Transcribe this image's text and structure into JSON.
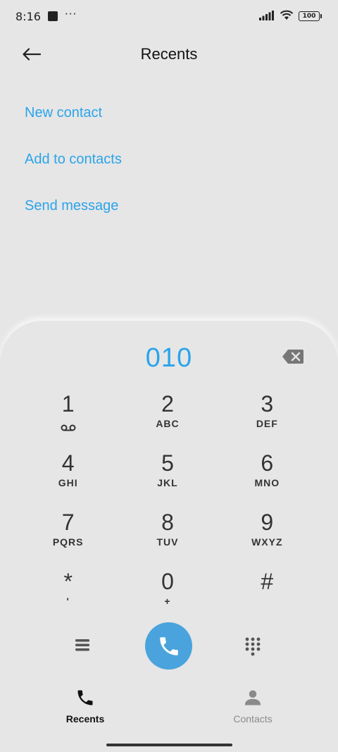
{
  "status_bar": {
    "time": "8:16",
    "dots": "···",
    "battery": "100",
    "icons": [
      "notification-square-icon",
      "signal-icon",
      "wifi-icon",
      "battery-icon"
    ]
  },
  "header": {
    "title": "Recents",
    "back_icon": "back-arrow-icon"
  },
  "actions": [
    {
      "label": "New contact"
    },
    {
      "label": "Add to contacts"
    },
    {
      "label": "Send message"
    }
  ],
  "dialer": {
    "number": "010",
    "backspace_icon": "backspace-icon",
    "keys": [
      {
        "digit": "1",
        "letters": ""
      },
      {
        "digit": "2",
        "letters": "ABC"
      },
      {
        "digit": "3",
        "letters": "DEF"
      },
      {
        "digit": "4",
        "letters": "GHI"
      },
      {
        "digit": "5",
        "letters": "JKL"
      },
      {
        "digit": "6",
        "letters": "MNO"
      },
      {
        "digit": "7",
        "letters": "PQRS"
      },
      {
        "digit": "8",
        "letters": "TUV"
      },
      {
        "digit": "9",
        "letters": "WXYZ"
      },
      {
        "digit": "*",
        "letters": "'"
      },
      {
        "digit": "0",
        "letters": "+"
      },
      {
        "digit": "#",
        "letters": ""
      }
    ],
    "call_icon": "phone-icon"
  },
  "bottom_nav": {
    "items": [
      {
        "label": "Recents",
        "active": true,
        "icon": "phone-icon"
      },
      {
        "label": "Contacts",
        "active": false,
        "icon": "person-icon"
      }
    ]
  },
  "colors": {
    "accent": "#2ba4ea",
    "call_button": "#4aa3dc",
    "background": "#e6e6e6"
  }
}
